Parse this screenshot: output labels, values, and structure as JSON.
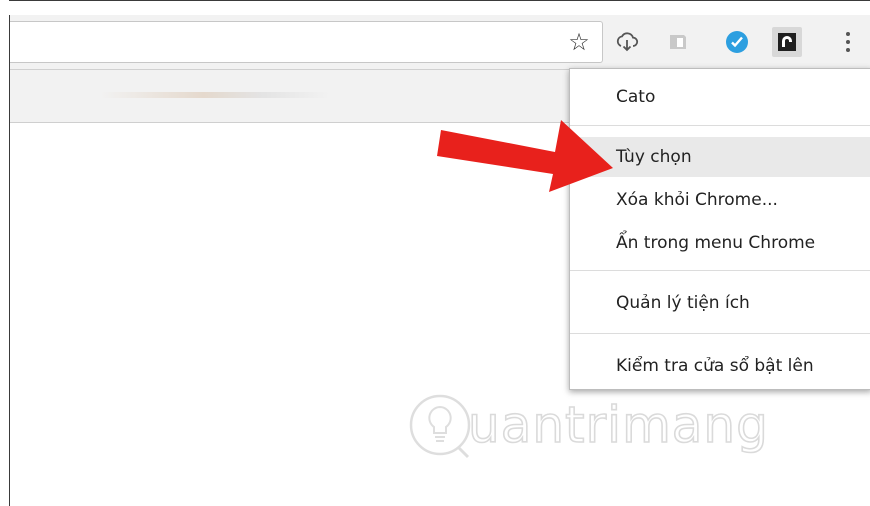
{
  "toolbar": {
    "bookmark_icon": "star-outline",
    "extensions": [
      {
        "name": "cloud-download-extension",
        "icon": "cloud-download-icon"
      },
      {
        "name": "gray-extension",
        "icon": "gray-box-icon"
      },
      {
        "name": "blue-check-extension",
        "icon": "blue-check-icon"
      },
      {
        "name": "cato-extension",
        "icon": "cato-icon"
      }
    ],
    "menu_icon": "kebab-icon"
  },
  "context_menu": {
    "items": [
      {
        "label": "Cato"
      },
      {
        "label": "Tùy chọn"
      },
      {
        "label": "Xóa khỏi Chrome..."
      },
      {
        "label": "Ẩn trong menu Chrome"
      },
      {
        "label": "Quản lý tiện ích"
      },
      {
        "label": "Kiểm tra cửa sổ bật lên"
      }
    ],
    "hovered_index": 1
  },
  "annotation": {
    "arrow_color": "#e8211c"
  },
  "watermark": {
    "text": "uantrimang"
  },
  "colors": {
    "toolbar_bg": "#f2f2f2",
    "menu_hover": "#e9e9e9",
    "blue_icon": "#2d9fe0"
  }
}
